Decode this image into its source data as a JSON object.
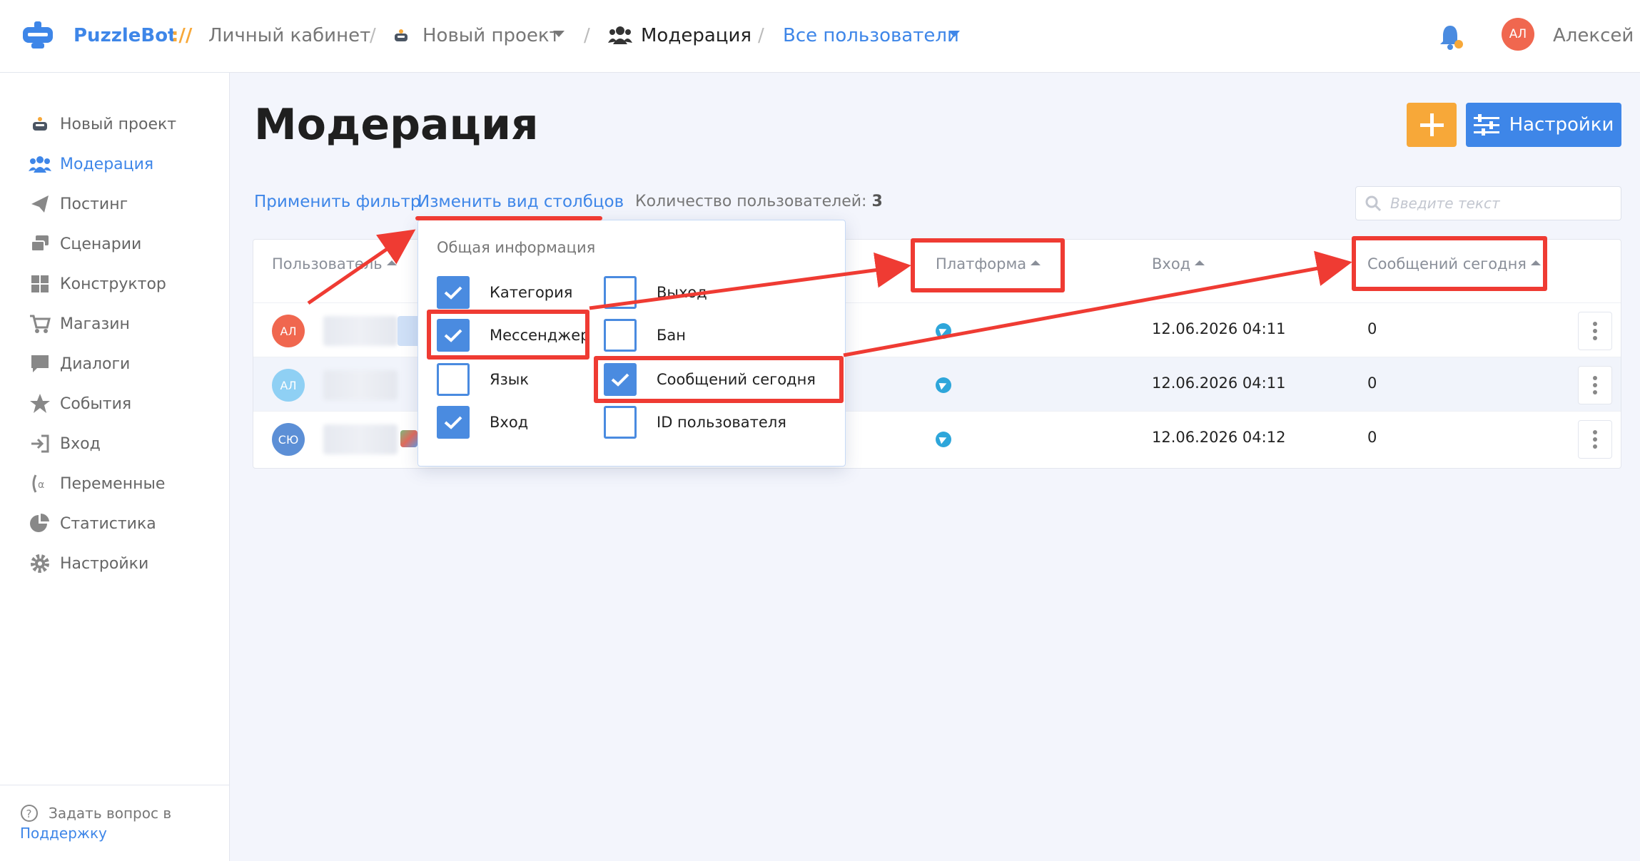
{
  "topbar": {
    "brand": "PuzzleBot",
    "brand_sep": "://",
    "cabinet": "Личный кабинет",
    "project": "Новый проект",
    "section": "Модерация",
    "users_filter": "Все пользователи",
    "user_initials": "АЛ",
    "user_name": "Алексей"
  },
  "sidebar": {
    "items": [
      {
        "label": "Новый проект",
        "icon": "bot-icon"
      },
      {
        "label": "Модерация",
        "icon": "users-icon"
      },
      {
        "label": "Постинг",
        "icon": "paper-plane-icon"
      },
      {
        "label": "Сценарии",
        "icon": "scenarios-icon"
      },
      {
        "label": "Конструктор",
        "icon": "grid-icon"
      },
      {
        "label": "Магазин",
        "icon": "cart-icon"
      },
      {
        "label": "Диалоги",
        "icon": "chat-icon"
      },
      {
        "label": "События",
        "icon": "star-icon"
      },
      {
        "label": "Вход",
        "icon": "sign-in-icon"
      },
      {
        "label": "Переменные",
        "icon": "variable-icon"
      },
      {
        "label": "Статистика",
        "icon": "pie-chart-icon"
      },
      {
        "label": "Настройки",
        "icon": "gear-icon"
      }
    ],
    "support_text": "Задать вопрос в",
    "support_link": "Поддержку"
  },
  "main": {
    "title": "Модерация",
    "add_button": "+",
    "settings_button": "Настройки",
    "apply_filter": "Применить фильтр",
    "change_columns": "Изменить вид столбцов",
    "count_label": "Количество пользователей:",
    "count_value": "3",
    "search_placeholder": "Введите текст"
  },
  "table": {
    "headers": {
      "user": "Пользователь",
      "platform": "Платформа",
      "login": "Вход",
      "messages_today": "Сообщений сегодня"
    },
    "rows": [
      {
        "initials": "АЛ",
        "color": "#f0674f",
        "login": "12.06.2026 04:11",
        "messages": "0"
      },
      {
        "initials": "АЛ",
        "color": "#8fd0f4",
        "login": "12.06.2026 04:11",
        "messages": "0"
      },
      {
        "initials": "СЮ",
        "color": "#5c8fd6",
        "login": "12.06.2026 04:12",
        "messages": "0"
      }
    ]
  },
  "dropdown": {
    "heading": "Общая информация",
    "options": [
      {
        "label": "Категория",
        "checked": true
      },
      {
        "label": "Выход",
        "checked": false
      },
      {
        "label": "Мессенджер",
        "checked": true
      },
      {
        "label": "Бан",
        "checked": false
      },
      {
        "label": "Язык",
        "checked": false
      },
      {
        "label": "Сообщений сегодня",
        "checked": true
      },
      {
        "label": "Вход",
        "checked": true
      },
      {
        "label": "ID пользователя",
        "checked": false
      }
    ]
  },
  "colors": {
    "accent": "#3e86e8",
    "add_button": "#f7a839",
    "annotation": "#ef3b33",
    "telegram": "#2ea6da"
  }
}
